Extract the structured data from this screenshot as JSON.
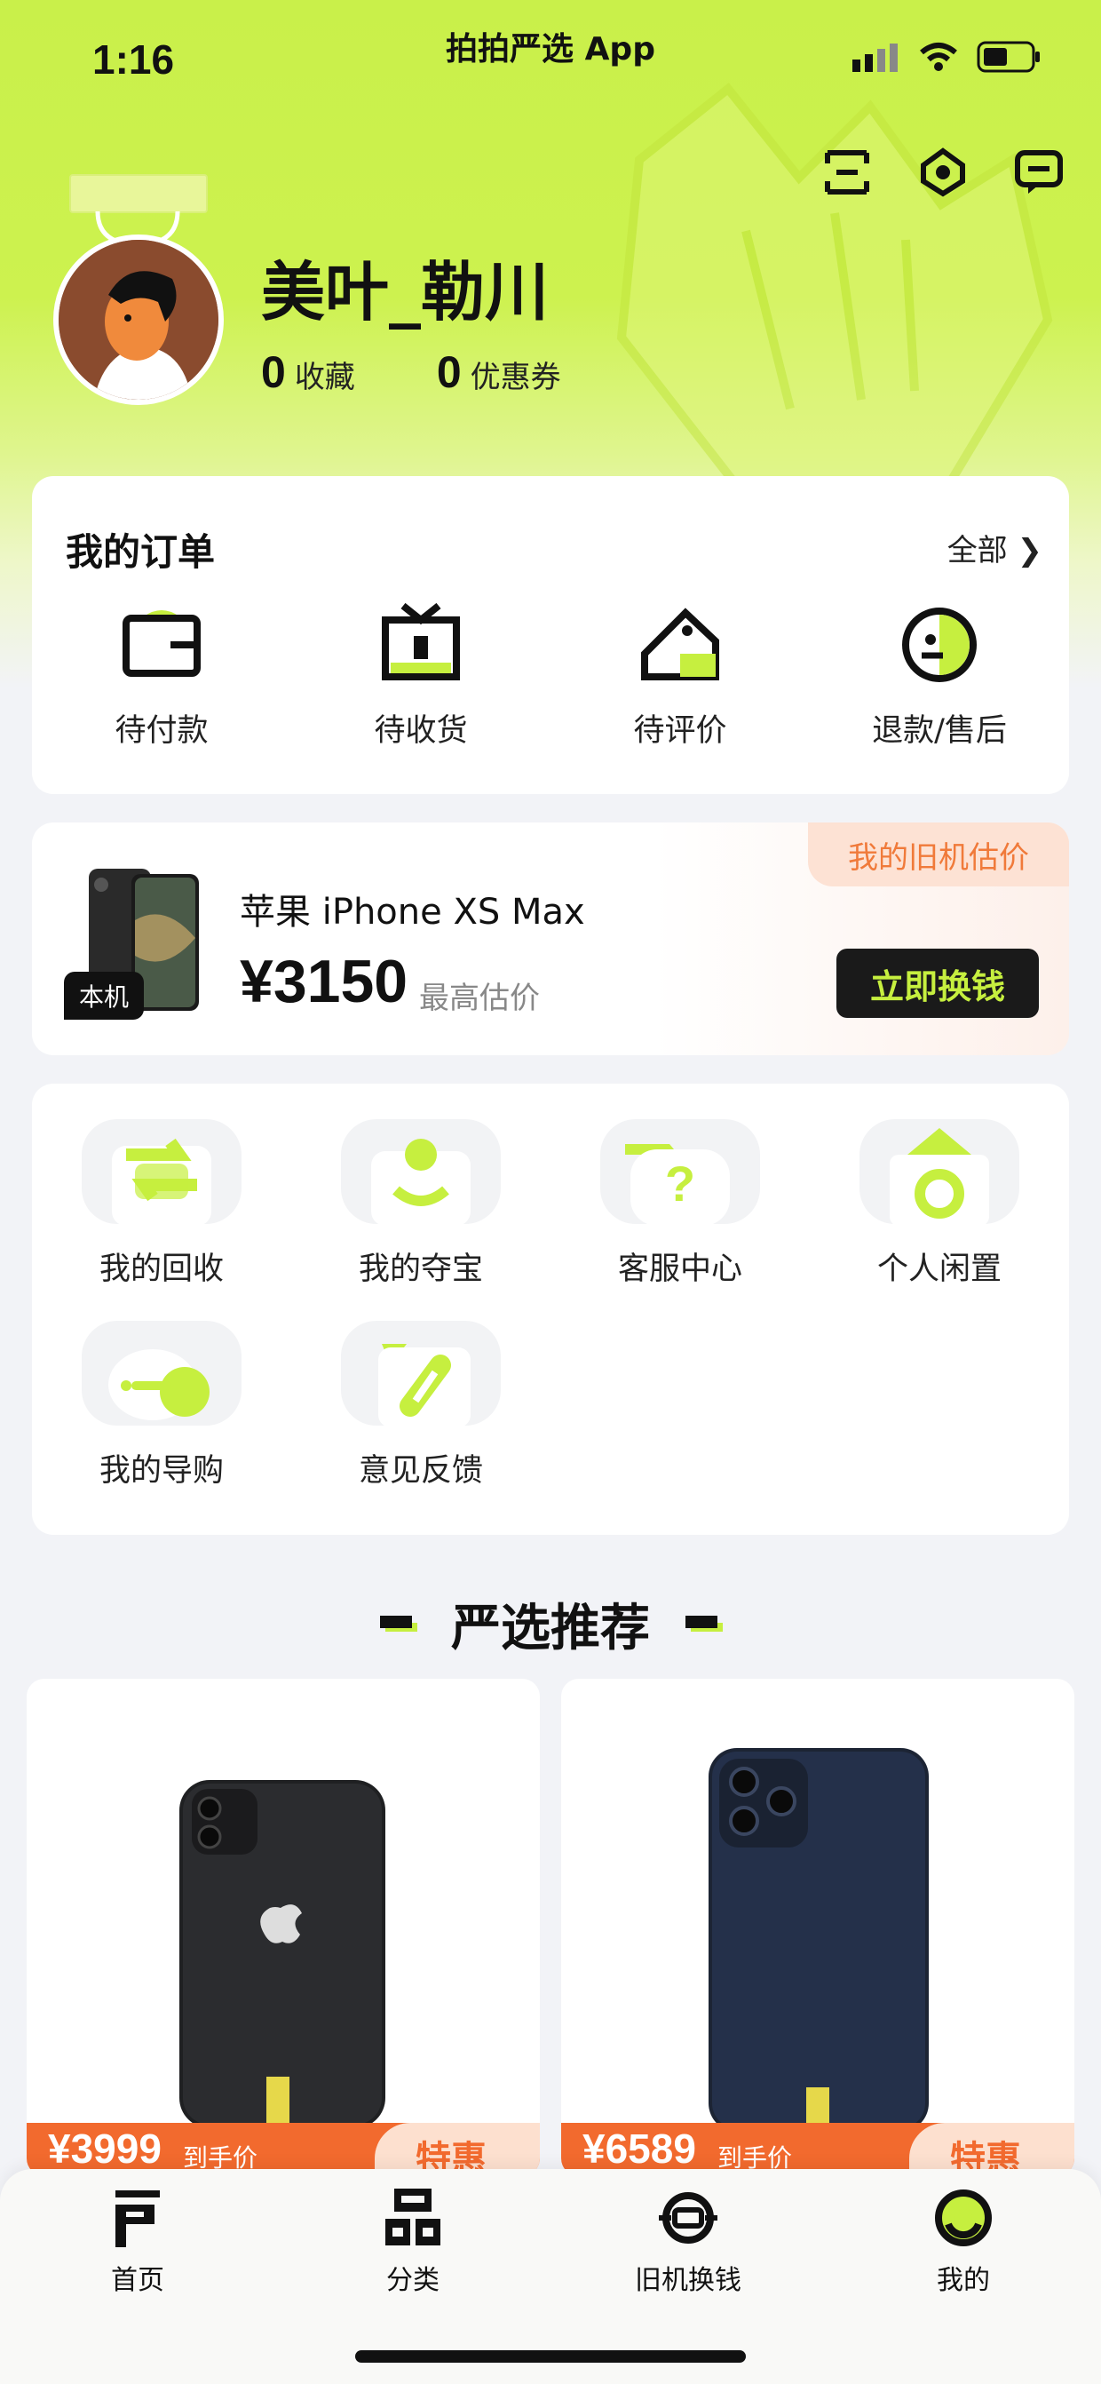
{
  "status_bar": {
    "time": "1:16",
    "app_title": "拍拍严选 App"
  },
  "profile": {
    "username": "美叶_勒川",
    "stats": [
      {
        "value": "0",
        "label": "收藏"
      },
      {
        "value": "0",
        "label": "优惠券"
      }
    ]
  },
  "header_icons": [
    "scan-icon",
    "settings-icon",
    "message-icon"
  ],
  "orders": {
    "title": "我的订单",
    "all_label": "全部",
    "items": [
      {
        "label": "待付款",
        "icon": "wallet-icon"
      },
      {
        "label": "待收货",
        "icon": "package-icon"
      },
      {
        "label": "待评价",
        "icon": "review-icon"
      },
      {
        "label": "退款/售后",
        "icon": "refund-icon"
      }
    ]
  },
  "trade_in": {
    "tag": "我的旧机估价",
    "badge": "本机",
    "model": "苹果 iPhone XS Max",
    "price": "¥3150",
    "price_label": "最高估价",
    "button": "立即换钱"
  },
  "services": [
    {
      "label": "我的回收",
      "icon": "recycle-icon"
    },
    {
      "label": "我的夺宝",
      "icon": "treasure-icon"
    },
    {
      "label": "客服中心",
      "icon": "help-icon"
    },
    {
      "label": "个人闲置",
      "icon": "idle-icon"
    },
    {
      "label": "我的导购",
      "icon": "guide-icon"
    },
    {
      "label": "意见反馈",
      "icon": "feedback-icon"
    }
  ],
  "recommend": {
    "title": "严选推荐",
    "products": [
      {
        "price": "¥3999",
        "price_label": "到手价",
        "badge": "特惠"
      },
      {
        "price": "¥6589",
        "price_label": "到手价",
        "badge": "特惠"
      }
    ]
  },
  "tab_bar": [
    {
      "label": "首页",
      "icon": "home-icon"
    },
    {
      "label": "分类",
      "icon": "category-icon"
    },
    {
      "label": "旧机换钱",
      "icon": "trade-in-icon"
    },
    {
      "label": "我的",
      "icon": "profile-icon"
    }
  ],
  "colors": {
    "accent": "#c6ef3f",
    "orange": "#f26a2e",
    "dark": "#111111"
  }
}
